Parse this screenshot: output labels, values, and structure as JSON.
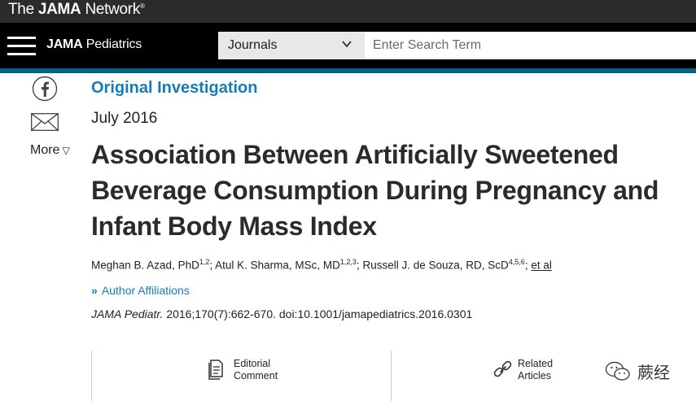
{
  "network": {
    "prefix": "The ",
    "name": "JAMA",
    "suffix": " Network",
    "mark": "®"
  },
  "header": {
    "journal_bold": "JAMA",
    "journal_rest": " Pediatrics",
    "journals_select": "Journals",
    "search_placeholder": "Enter Search Term"
  },
  "sidebar": {
    "more_label": "More",
    "more_arrow": "▽",
    "icons": [
      "facebook-icon",
      "email-icon"
    ]
  },
  "article": {
    "type": "Original Investigation",
    "date": "July 2016",
    "title": "Association Between Artificially Sweetened Beverage Consumption During Pregnancy and Infant Body Mass Index",
    "authors": [
      {
        "name": "Meghan B. Azad, PhD",
        "sup": "1,2",
        "sep": "; "
      },
      {
        "name": "Atul K. Sharma, MSc, MD",
        "sup": "1,2,3",
        "sep": "; "
      },
      {
        "name": "Russell J. de Souza, RD, ScD",
        "sup": "4,5,6",
        "sep": "; "
      }
    ],
    "et_al": "et al",
    "affiliations_chevron": "»",
    "affiliations_label": "Author Affiliations",
    "citation_journal": "JAMA Pediatr.",
    "citation_rest": " 2016;170(7):662-670. doi:10.1001/jamapediatrics.2016.0301"
  },
  "actions": [
    {
      "line1": "Editorial",
      "line2": "Comment",
      "icon": "document-icon"
    },
    {
      "line1": "Related",
      "line2": "Articles",
      "icon": "link-icon"
    }
  ],
  "watermark": {
    "text": "蕨经",
    "icon": "wechat-icon"
  },
  "colors": {
    "accent": "#0b5f7a",
    "link": "#1a7bb3",
    "topbar": "#2b2b2b",
    "navbar": "#000000"
  }
}
